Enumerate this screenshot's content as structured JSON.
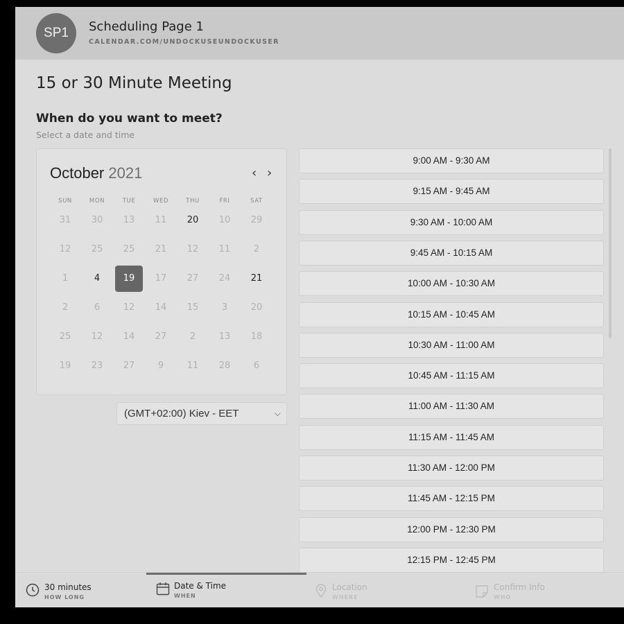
{
  "header": {
    "avatar_initials": "SP1",
    "title": "Scheduling Page 1",
    "url": "CALENDAR.COM/UNDOCKUSEUNDOCKUSER"
  },
  "page": {
    "title": "15 or 30 Minute Meeting",
    "question": "When do you want to meet?",
    "subtitle": "Select a date and time"
  },
  "calendar": {
    "month": "October",
    "year": "2021",
    "prev_icon": "‹",
    "next_icon": "›",
    "weekdays": [
      "SUN",
      "MON",
      "TUE",
      "WED",
      "THU",
      "FRI",
      "SAT"
    ],
    "weeks": [
      [
        {
          "d": "31",
          "s": "dis"
        },
        {
          "d": "30",
          "s": "dis"
        },
        {
          "d": "13",
          "s": "dis"
        },
        {
          "d": "11",
          "s": "dis"
        },
        {
          "d": "20",
          "s": "avail"
        },
        {
          "d": "10",
          "s": "dis"
        },
        {
          "d": "29",
          "s": "dis"
        }
      ],
      [
        {
          "d": "12",
          "s": "dis"
        },
        {
          "d": "25",
          "s": "dis"
        },
        {
          "d": "25",
          "s": "dis"
        },
        {
          "d": "21",
          "s": "dis"
        },
        {
          "d": "12",
          "s": "dis"
        },
        {
          "d": "11",
          "s": "dis"
        },
        {
          "d": "2",
          "s": "dis"
        }
      ],
      [
        {
          "d": "1",
          "s": "dis"
        },
        {
          "d": "4",
          "s": "avail"
        },
        {
          "d": "19",
          "s": "selected"
        },
        {
          "d": "17",
          "s": "dis"
        },
        {
          "d": "27",
          "s": "dis"
        },
        {
          "d": "24",
          "s": "dis"
        },
        {
          "d": "21",
          "s": "avail"
        }
      ],
      [
        {
          "d": "2",
          "s": "dis"
        },
        {
          "d": "6",
          "s": "dis"
        },
        {
          "d": "12",
          "s": "dis"
        },
        {
          "d": "14",
          "s": "dis"
        },
        {
          "d": "15",
          "s": "dis"
        },
        {
          "d": "3",
          "s": "dis"
        },
        {
          "d": "20",
          "s": "dis"
        }
      ],
      [
        {
          "d": "25",
          "s": "dis"
        },
        {
          "d": "12",
          "s": "dis"
        },
        {
          "d": "14",
          "s": "dis"
        },
        {
          "d": "27",
          "s": "dis"
        },
        {
          "d": "2",
          "s": "dis"
        },
        {
          "d": "13",
          "s": "dis"
        },
        {
          "d": "18",
          "s": "dis"
        }
      ],
      [
        {
          "d": "19",
          "s": "dis"
        },
        {
          "d": "23",
          "s": "dis"
        },
        {
          "d": "27",
          "s": "dis"
        },
        {
          "d": "9",
          "s": "dis"
        },
        {
          "d": "11",
          "s": "dis"
        },
        {
          "d": "28",
          "s": "dis"
        },
        {
          "d": "6",
          "s": "dis"
        }
      ]
    ]
  },
  "timezone": {
    "value": "(GMT+02:00) Kiev - EET",
    "chevron": "⌵"
  },
  "slots": [
    "9:00 AM - 9:30 AM",
    "9:15 AM - 9:45 AM",
    "9:30 AM - 10:00 AM",
    "9:45 AM - 10:15 AM",
    "10:00 AM - 10:30 AM",
    "10:15 AM - 10:45 AM",
    "10:30 AM - 11:00 AM",
    "10:45 AM - 11:15 AM",
    "11:00 AM - 11:30 AM",
    "11:15 AM - 11:45 AM",
    "11:30 AM - 12:00 PM",
    "11:45 AM - 12:15 PM",
    "12:00 PM - 12:30 PM",
    "12:15 PM - 12:45 PM"
  ],
  "footer": {
    "steps": [
      {
        "label": "30 minutes",
        "sub": "HOW LONG",
        "icon": "clock-icon",
        "state": "done"
      },
      {
        "label": "Date & Time",
        "sub": "WHEN",
        "icon": "calendar-icon",
        "state": "active"
      },
      {
        "label": "Location",
        "sub": "WHERE",
        "icon": "location-pin-icon",
        "state": "pending"
      },
      {
        "label": "Confirm Info",
        "sub": "WHO",
        "icon": "note-icon",
        "state": "pending"
      }
    ]
  },
  "colors": {
    "selected_day": "#666666",
    "header_bg": "#c9c9c9",
    "page_bg": "#dcdcdc"
  }
}
